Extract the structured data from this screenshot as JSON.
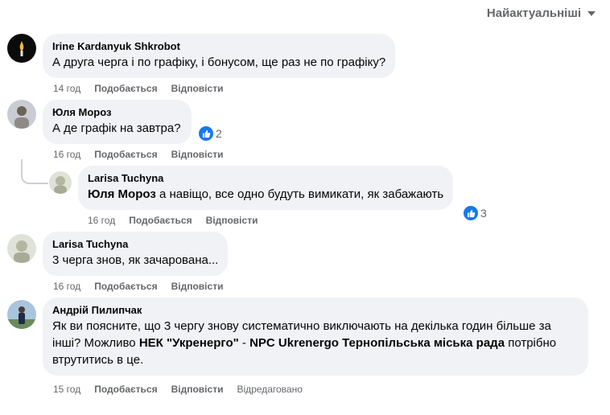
{
  "sort": {
    "label": "Найактуальніші",
    "icon": "triangle-down-icon"
  },
  "comments": [
    {
      "author": "Irine Kardanyuk Shkrobot",
      "text": "А друга черга і по графіку, і бонусом, ще раз не по графіку?",
      "time": "14 год",
      "like": "Подобається",
      "reply": "Відповісти"
    },
    {
      "author": "Юля Мороз",
      "text": "А де графік на завтра?",
      "reactions": "2",
      "time": "16 год",
      "like": "Подобається",
      "reply": "Відповісти"
    },
    {
      "author": "Larisa Tuchyna",
      "mention": "Юля Мороз",
      "text": " а навіщо, все одно будуть вимикати, як забажають",
      "reactions": "3",
      "time": "16 год",
      "like": "Подобається",
      "reply": "Відповісти"
    },
    {
      "author": "Larisa Tuchyna",
      "text": "3 черга знов, як зачарована...",
      "time": "16 год",
      "like": "Подобається",
      "reply": "Відповісти"
    },
    {
      "author": "Андрій Пилипчак",
      "text_part1": "Як ви поясните, що 3 чергу знову систематично виключають на декілька годин більше за інші? Можливо ",
      "mention1": "НЕК \"Укренерго\"",
      "sep": " - ",
      "mention2": "NPC Ukrenergo",
      "space": " ",
      "mention3": "Тернопільська міська рада",
      "text_part2": " потрібно втрутитись в це.",
      "time": "15 год",
      "like": "Подобається",
      "reply": "Відповісти",
      "edited": "Відредаговано"
    }
  ],
  "colors": {
    "bubble": "#f0f2f5",
    "like_blue": "#1877f2",
    "meta": "#65676b"
  }
}
